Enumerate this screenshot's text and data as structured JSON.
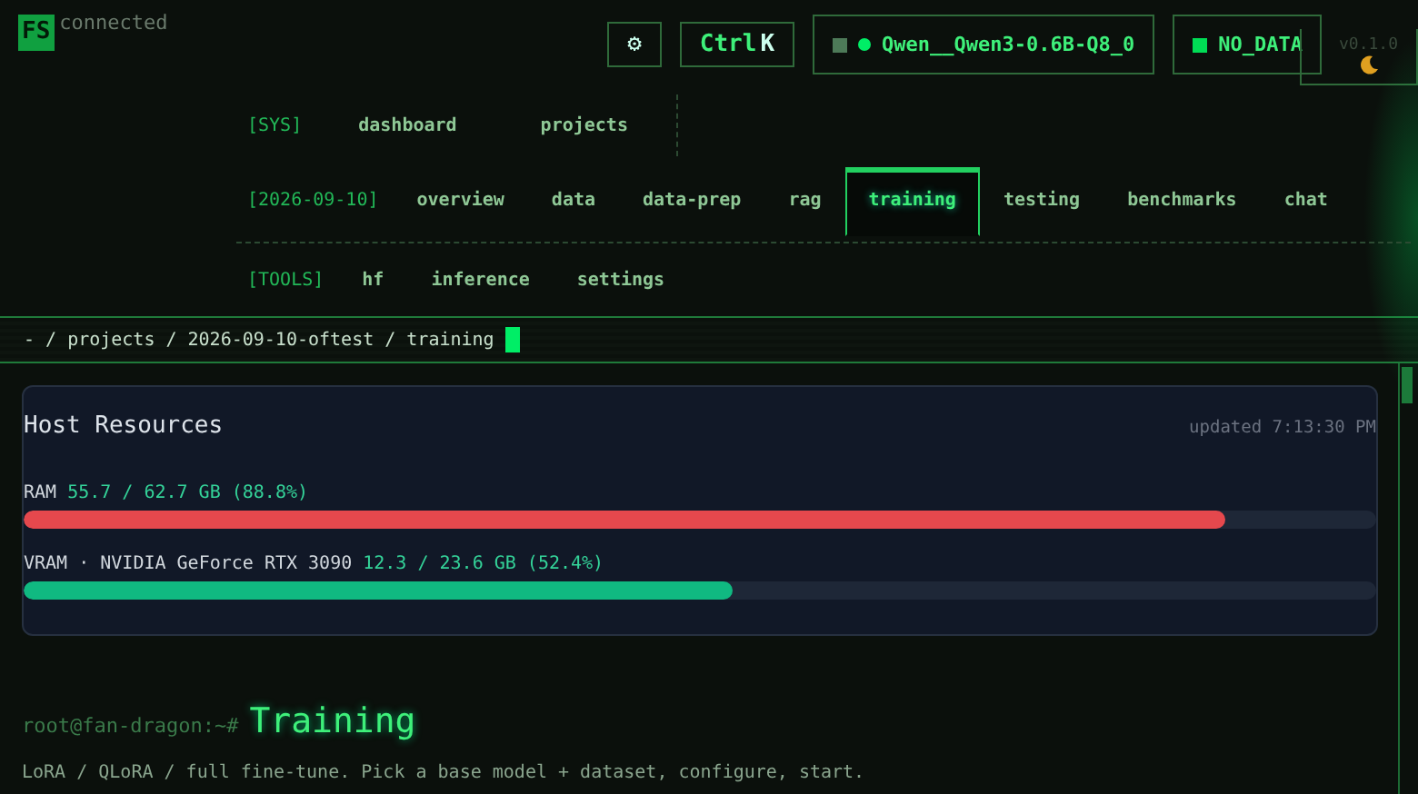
{
  "brand": {
    "logo": "FS",
    "status": "connected"
  },
  "header": {
    "settings_icon": "⚙",
    "shortcut": {
      "ctrl": "Ctrl",
      "key": "K"
    },
    "model": {
      "name": "Qwen__Qwen3-0.6B-Q8_0"
    },
    "data_status": {
      "label": "NO_DATA"
    },
    "version": "v0.1.0"
  },
  "nav": [
    {
      "label": "[SYS]",
      "items": [
        {
          "text": "dashboard",
          "selected": false
        },
        {
          "text": "projects",
          "selected": false
        }
      ]
    },
    {
      "label": "[2026-09-10]",
      "items": [
        {
          "text": "overview",
          "selected": false
        },
        {
          "text": "data",
          "selected": false
        },
        {
          "text": "data-prep",
          "selected": false
        },
        {
          "text": "rag",
          "selected": false
        },
        {
          "text": "training",
          "selected": true
        },
        {
          "text": "testing",
          "selected": false
        },
        {
          "text": "benchmarks",
          "selected": false
        },
        {
          "text": "chat",
          "selected": false
        }
      ]
    },
    {
      "label": "[TOOLS]",
      "items": [
        {
          "text": "hf",
          "selected": false
        },
        {
          "text": "inference",
          "selected": false
        },
        {
          "text": "settings",
          "selected": false
        }
      ]
    }
  ],
  "breadcrumb": {
    "separator": "/",
    "items": [
      "-",
      "projects",
      "2026-09-10-oftest",
      "training"
    ]
  },
  "resources": {
    "title": "Host Resources",
    "updated": "updated 7:13:30 PM",
    "meters": [
      {
        "name": "RAM",
        "reading": "55.7 / 62.7 GB (88.8%)",
        "level": 0.888,
        "color": "#e5484d"
      },
      {
        "name": "VRAM · NVIDIA GeForce RTX 3090",
        "reading": "12.3 / 23.6 GB (52.4%)",
        "level": 0.524,
        "color": "#10b981"
      }
    ]
  },
  "page": {
    "prompt": "root@fan-dragon:~#",
    "title": "Training",
    "description": "LoRA / QLoRA / full fine-tune. Pick a base model + dataset, configure, start."
  }
}
